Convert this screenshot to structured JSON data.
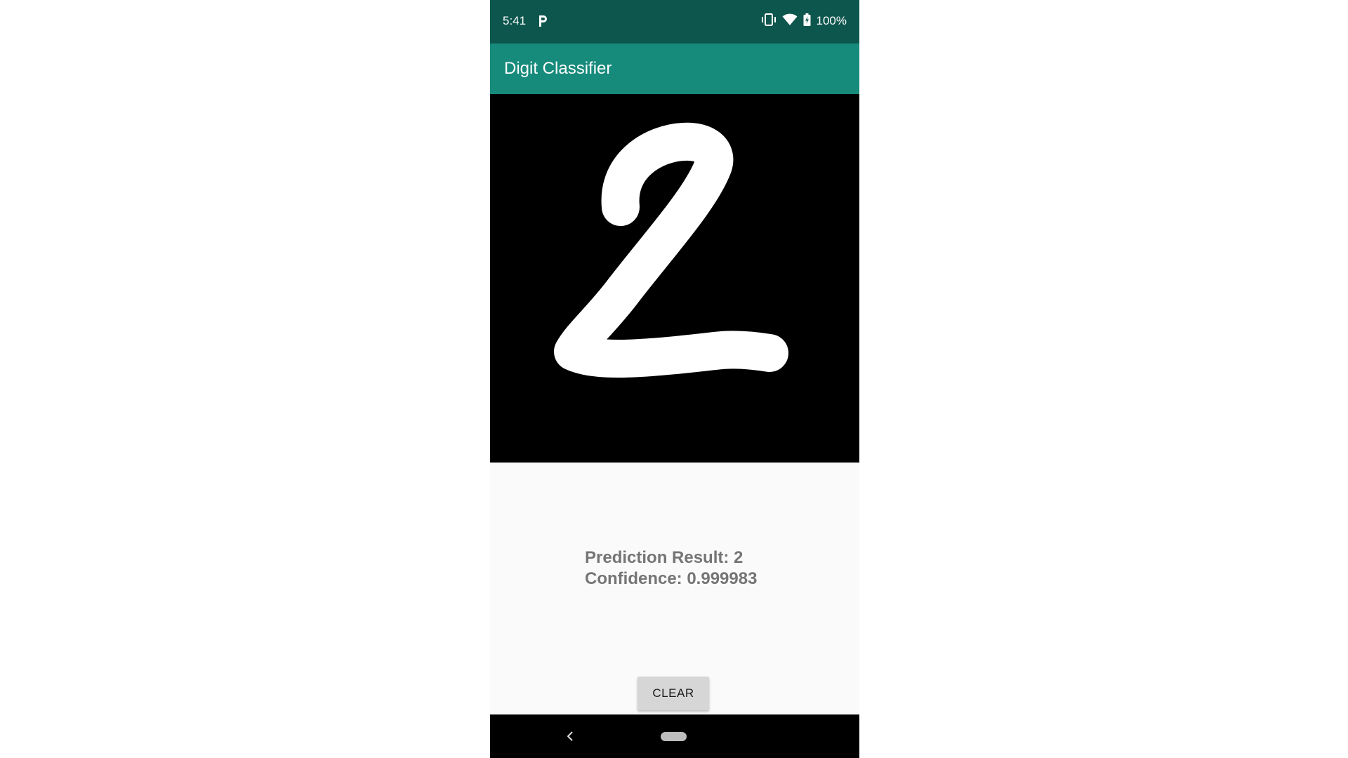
{
  "status_bar": {
    "time": "5:41",
    "app_notification_icon": "p-icon",
    "vibrate_icon": "vibrate-icon",
    "wifi_icon": "wifi-icon",
    "battery_icon": "battery-charging-icon",
    "battery_level": "100%"
  },
  "app_bar": {
    "title": "Digit Classifier"
  },
  "drawing_canvas": {
    "drawn_digit": "2"
  },
  "result": {
    "prediction": "Prediction Result: 2",
    "confidence": "Confidence: 0.999983"
  },
  "actions": {
    "clear_label": "CLEAR"
  },
  "navigation": {
    "back_icon": "back-chevron-icon",
    "home_icon": "home-pill-icon"
  },
  "colors": {
    "status_bar": "#0d564d",
    "app_bar": "#168a7b",
    "canvas_background": "#000000",
    "stroke": "#ffffff",
    "result_text": "#757575",
    "button": "#d6d6d6"
  }
}
